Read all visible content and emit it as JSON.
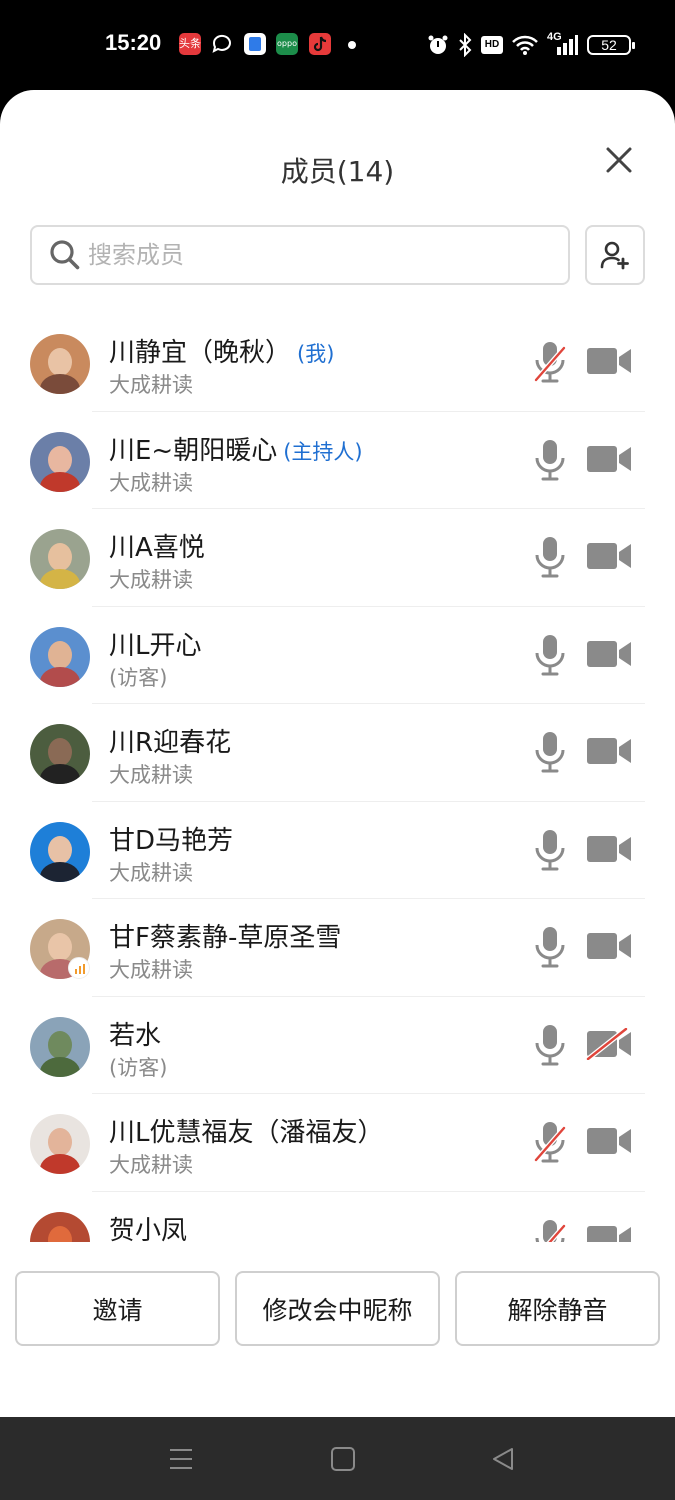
{
  "status_bar": {
    "time": "15:20",
    "app_icons": [
      "toutiao-icon",
      "chat-bubble-icon",
      "notes-icon",
      "oppo-icon",
      "tiktok-icon"
    ],
    "app_icon_labels": [
      "头条",
      "",
      "",
      "oppo",
      ""
    ],
    "right_icons": [
      "alarm-icon",
      "bluetooth-icon",
      "hd-icon",
      "wifi-icon",
      "4g-signal-icon"
    ],
    "network": "4G",
    "battery": "52"
  },
  "sheet": {
    "title": "成员(14)",
    "search_placeholder": "搜索成员"
  },
  "members": [
    {
      "name": "川静宜（晚秋）",
      "tag": "(我)",
      "subtitle": "大成耕读",
      "mic_muted": true,
      "camera_off": false,
      "avatar_colors": [
        "#c98a5e",
        "#e9c3a5",
        "#7a4b3a"
      ]
    },
    {
      "name": "川E~朝阳暖心",
      "tag": "(主持人)",
      "subtitle": "大成耕读",
      "mic_muted": false,
      "camera_off": false,
      "avatar_colors": [
        "#6b7fa8",
        "#e8b7a0",
        "#c0392b"
      ]
    },
    {
      "name": "川A喜悦",
      "tag": "",
      "subtitle": "大成耕读",
      "mic_muted": false,
      "camera_off": false,
      "avatar_colors": [
        "#9aa38f",
        "#e6c09e",
        "#d4b446"
      ]
    },
    {
      "name": "川L开心",
      "tag": "",
      "subtitle": "(访客)",
      "mic_muted": false,
      "camera_off": false,
      "avatar_colors": [
        "#5b8fcf",
        "#e0b394",
        "#b24c4c"
      ]
    },
    {
      "name": "川R迎春花",
      "tag": "",
      "subtitle": "大成耕读",
      "mic_muted": false,
      "camera_off": false,
      "avatar_colors": [
        "#4c5d3f",
        "#8a6a55",
        "#222222"
      ]
    },
    {
      "name": "甘D马艳芳",
      "tag": "",
      "subtitle": "大成耕读",
      "mic_muted": false,
      "camera_off": false,
      "avatar_colors": [
        "#1e7fd8",
        "#e7c1a6",
        "#1c2433"
      ]
    },
    {
      "name": "甘F蔡素静-草原圣雪",
      "tag": "",
      "subtitle": "大成耕读",
      "mic_muted": false,
      "camera_off": false,
      "avatar_colors": [
        "#c7a98a",
        "#e9c5a8",
        "#b86b6b"
      ],
      "speaking_badge": true
    },
    {
      "name": "若水",
      "tag": "",
      "subtitle": "(访客)",
      "mic_muted": false,
      "camera_off": true,
      "avatar_colors": [
        "#8aa3b8",
        "#6f8a5e",
        "#4d6a3d"
      ]
    },
    {
      "name": "川L优慧福友（潘福友）",
      "tag": "",
      "subtitle": "大成耕读",
      "mic_muted": true,
      "camera_off": false,
      "avatar_colors": [
        "#e9e4e0",
        "#e3b49a",
        "#c0392b"
      ]
    },
    {
      "name": "贺小凤",
      "tag": "",
      "subtitle": "",
      "mic_muted": true,
      "camera_off": false,
      "avatar_colors": [
        "#b44a32",
        "#e06a3c",
        "#7a2d1c"
      ]
    }
  ],
  "buttons": {
    "invite": "邀请",
    "rename": "修改会中昵称",
    "unmute_all": "解除静音"
  },
  "colors": {
    "accent_tag": "#1f6fd1",
    "muted_slash": "#e0453b",
    "icon_gray": "#8a8a8a"
  }
}
